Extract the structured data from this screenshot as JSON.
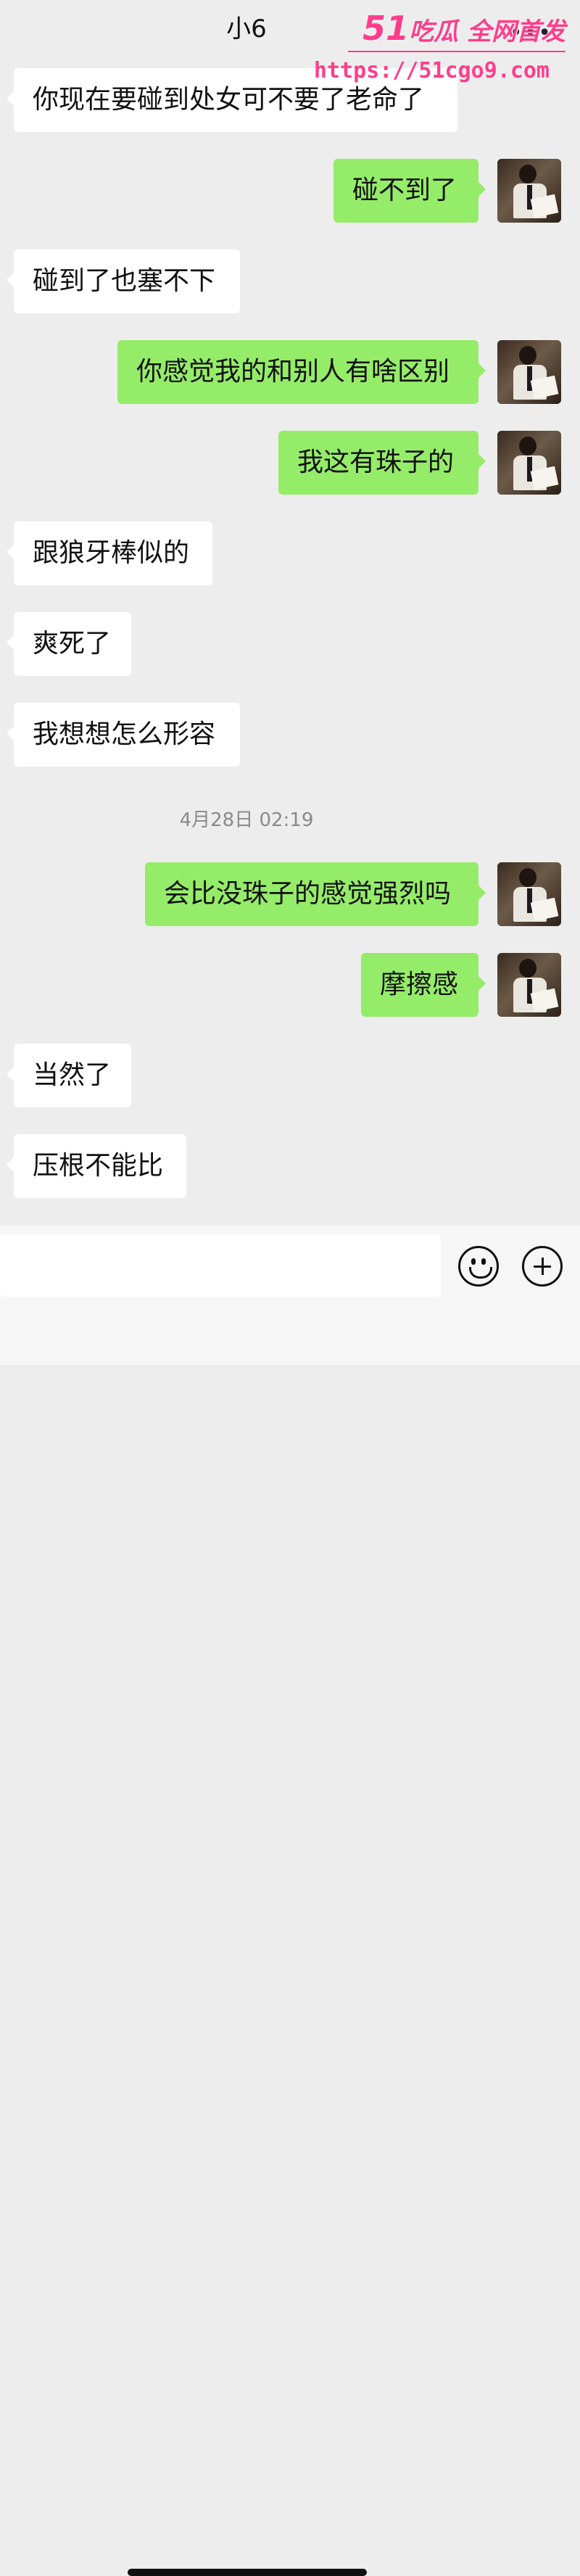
{
  "header": {
    "title": "小6",
    "more_icon": "more-dots-icon"
  },
  "watermark": {
    "logo_number": "51",
    "logo_text": "吃瓜 全网首发",
    "url": "https://51cgo9.com",
    "color": "#ff3d8b"
  },
  "colors": {
    "outgoing_bubble": "#95ec69",
    "incoming_bubble": "#ffffff",
    "background": "#ededed"
  },
  "messages": [
    {
      "side": "in",
      "text": "你现在要碰到处女可不要了老命了"
    },
    {
      "side": "out",
      "text": "碰不到了"
    },
    {
      "side": "in",
      "text": "碰到了也塞不下"
    },
    {
      "side": "out",
      "text": "你感觉我的和别人有啥区别"
    },
    {
      "side": "out",
      "text": "我这有珠子的"
    },
    {
      "side": "in",
      "text": "跟狼牙棒似的"
    },
    {
      "side": "in",
      "text": "爽死了"
    },
    {
      "side": "in",
      "text": "我想想怎么形容"
    },
    {
      "side": "out",
      "text": "会比没珠子的感觉强烈吗"
    },
    {
      "side": "out",
      "text": "摩擦感"
    },
    {
      "side": "in",
      "text": "当然了"
    },
    {
      "side": "in",
      "text": "压根不能比"
    }
  ],
  "timestamp": "4月28日 02:19",
  "input_bar": {
    "value": "",
    "emoji_icon": "emoji-icon",
    "plus_icon": "plus-icon"
  }
}
